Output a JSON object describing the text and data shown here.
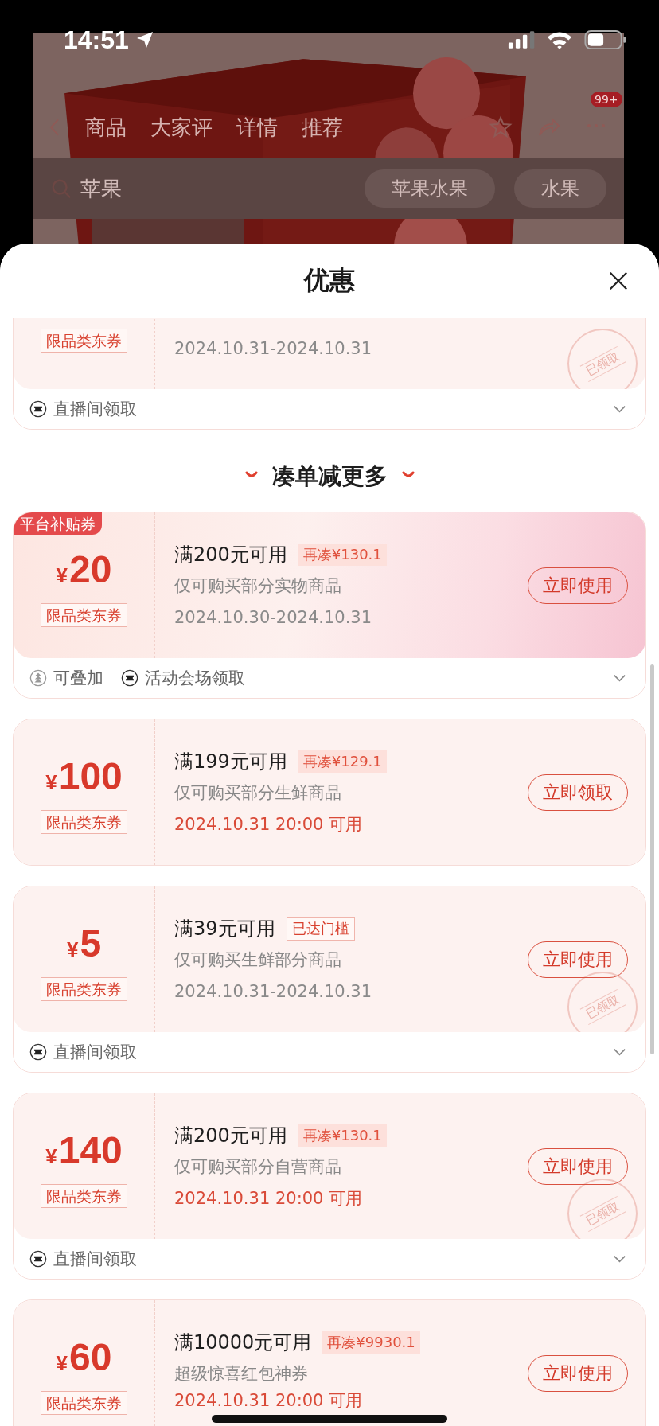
{
  "status_bar": {
    "time": "14:51"
  },
  "background_page": {
    "nav_tabs": [
      "商品",
      "大家评",
      "详情",
      "推荐"
    ],
    "badge": "99+",
    "search": {
      "value": "苹果"
    },
    "tags": [
      "苹果水果",
      "水果"
    ]
  },
  "sheet": {
    "title": "优惠"
  },
  "coupon_groups": [
    {
      "coupons": [
        {
          "category_tag": "限品类东券",
          "date": {
            "text": "2024.10.31-2024.10.31",
            "highlight": false
          },
          "stamp": "已领取",
          "footer": [
            {
              "kind": "ticket",
              "text": "直播间领取"
            }
          ]
        }
      ]
    },
    {
      "heading": "凑单减更多",
      "coupons": [
        {
          "promo_tag": "平台补贴券",
          "currency": "¥",
          "amount": "20",
          "category_tag": "限品类东券",
          "title": "满200元可用",
          "threshold_badge": {
            "kind": "gap",
            "text": "再凑¥130.1"
          },
          "scope": "仅可购买部分实物商品",
          "date": {
            "text": "2024.10.30-2024.10.31",
            "highlight": false
          },
          "button": "立即使用",
          "footer": [
            {
              "kind": "stack",
              "text": "可叠加"
            },
            {
              "kind": "ticket",
              "text": "活动会场领取"
            }
          ]
        },
        {
          "currency": "¥",
          "amount": "100",
          "category_tag": "限品类东券",
          "title": "满199元可用",
          "threshold_badge": {
            "kind": "gap",
            "text": "再凑¥129.1"
          },
          "scope": "仅可购买部分生鲜商品",
          "date": {
            "text": "2024.10.31 20:00 可用",
            "highlight": true
          },
          "button": "立即领取"
        },
        {
          "currency": "¥",
          "amount": "5",
          "category_tag": "限品类东券",
          "title": "满39元可用",
          "threshold_badge": {
            "kind": "reached",
            "text": "已达门槛"
          },
          "scope": "仅可购买生鲜部分商品",
          "date": {
            "text": "2024.10.31-2024.10.31",
            "highlight": false
          },
          "button": "立即使用",
          "stamp": "已领取",
          "footer": [
            {
              "kind": "ticket",
              "text": "直播间领取"
            }
          ]
        },
        {
          "currency": "¥",
          "amount": "140",
          "category_tag": "限品类东券",
          "title": "满200元可用",
          "threshold_badge": {
            "kind": "gap",
            "text": "再凑¥130.1"
          },
          "scope": "仅可购买部分自营商品",
          "date": {
            "text": "2024.10.31 20:00 可用",
            "highlight": true
          },
          "button": "立即使用",
          "stamp": "已领取",
          "footer": [
            {
              "kind": "ticket",
              "text": "直播间领取"
            }
          ]
        },
        {
          "currency": "¥",
          "amount": "60",
          "category_tag": "限品类东券",
          "title": "满10000元可用",
          "threshold_badge": {
            "kind": "gap",
            "text": "再凑¥9930.1"
          },
          "scope": "超级惊喜红包神券",
          "date": {
            "text": "2024.10.31 20:00 可用",
            "highlight": true
          },
          "button": "立即使用"
        }
      ]
    }
  ]
}
